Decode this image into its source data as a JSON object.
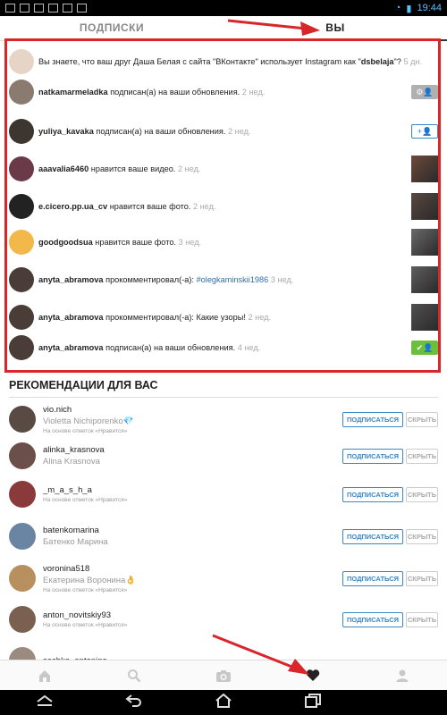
{
  "status_bar": {
    "time": "19:44"
  },
  "tabs": {
    "following": "ПОДПИСКИ",
    "you": "ВЫ"
  },
  "notifications": [
    {
      "user": "",
      "text": "Вы знаете, что ваш друг Даша Белая с сайта \"ВКонтакте\" использует Instagram как \"",
      "handle": "dsbelaja",
      "after": "\"?",
      "time": "5 дн.",
      "action": "none",
      "avatar_color": "#e6d4c7"
    },
    {
      "user": "natkamarmeladka",
      "text": "подписан(а) на ваши обновления.",
      "time": "2 нед.",
      "action": "following-gray",
      "avatar_color": "#8a7a70"
    },
    {
      "user": "yuliya_kavaka",
      "text": "подписан(а) на ваши обновления.",
      "time": "2 нед.",
      "action": "follow-outline",
      "avatar_color": "#3d3530"
    },
    {
      "user": "aaavalia6460",
      "text": "нравится ваше видео.",
      "time": "2 нед.",
      "action": "thumb",
      "avatar_color": "#6b3a48",
      "thumb_color": "#6e4a3c"
    },
    {
      "user": "e.cicero.pp.ua_cv",
      "text": "нравится ваше фото.",
      "time": "2 нед.",
      "action": "thumb",
      "avatar_color": "#222222",
      "thumb_color": "#5a4840"
    },
    {
      "user": "goodgoodsua",
      "text": "нравится ваше фото.",
      "time": "3 нед.",
      "action": "thumb",
      "avatar_color": "#f2b84a",
      "thumb_color": "#6a6a6a"
    },
    {
      "user": "anyta_abramova",
      "text": "прокомментировал(-а):",
      "tag": "#olegkaminskii1986",
      "time": "3 нед.",
      "action": "thumb",
      "avatar_color": "#4a3c36",
      "thumb_color": "#5e5e5e"
    },
    {
      "user": "anyta_abramova",
      "text": "прокомментировал(-а): Какие узоры!",
      "time": "2 нед.",
      "action": "thumb",
      "avatar_color": "#4a3c36",
      "thumb_color": "#505050"
    },
    {
      "user": "anyta_abramova",
      "text": "подписан(а) на ваши обновления.",
      "time": "4 нед.",
      "action": "following-green",
      "avatar_color": "#4a3c36"
    }
  ],
  "suggestions_title": "РЕКОМЕНДАЦИИ ДЛЯ ВАС",
  "suggestions": [
    {
      "username": "vio.nich",
      "fullname": "Violetta Nichiporenko💎",
      "hint": "На основе отметок «Нравится»",
      "subscribe": "ПОДПИСАТЬСЯ",
      "hide": "СКРЫТЬ",
      "avatar_color": "#5a4a44"
    },
    {
      "username": "alinka_krasnova",
      "fullname": "Alina Krasnova",
      "hint": "",
      "subscribe": "ПОДПИСАТЬСЯ",
      "hide": "СКРЫТЬ",
      "avatar_color": "#6a5048"
    },
    {
      "username": "_m_a_s_h_a",
      "fullname": "",
      "hint": "На основе отметок «Нравится»",
      "subscribe": "ПОДПИСАТЬСЯ",
      "hide": "СКРЫТЬ",
      "avatar_color": "#8a3a3a"
    },
    {
      "username": "batenkomarina",
      "fullname": "Батенко Марина",
      "hint": "",
      "subscribe": "ПОДПИСАТЬСЯ",
      "hide": "СКРЫТЬ",
      "avatar_color": "#6a84a4"
    },
    {
      "username": "voronina518",
      "fullname": "Екатерина Воронина👌",
      "hint": "На основе отметок «Нравится»",
      "subscribe": "ПОДПИСАТЬСЯ",
      "hide": "СКРЫТЬ",
      "avatar_color": "#b89060"
    },
    {
      "username": "anton_novitskiy93",
      "fullname": "",
      "hint": "На основе отметок «Нравится»",
      "subscribe": "ПОДПИСАТЬСЯ",
      "hide": "СКРЫТЬ",
      "avatar_color": "#7a6050"
    },
    {
      "username": "sashko_antonina",
      "fullname": "",
      "hint": "",
      "subscribe": "",
      "hide": "",
      "avatar_color": "#9a8a80"
    }
  ],
  "colors": {
    "accent": "#3b86c4",
    "highlight": "#d8262b",
    "green": "#6cbf3c"
  }
}
